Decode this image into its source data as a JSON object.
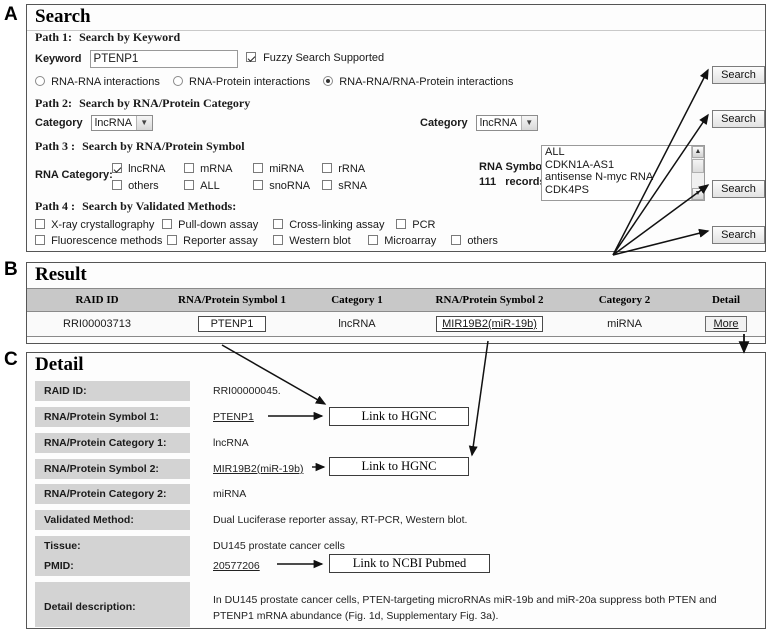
{
  "panels": {
    "a": {
      "letter": "A",
      "title": "Search"
    },
    "b": {
      "letter": "B",
      "title": "Result"
    },
    "c": {
      "letter": "C",
      "title": "Detail"
    }
  },
  "search": {
    "path1": {
      "num": "Path 1:",
      "title": "Search by Keyword"
    },
    "keyword_label": "Keyword",
    "keyword_value": "PTENP1",
    "fuzzy_label": "Fuzzy Search Supported",
    "fuzzy_checked": true,
    "interaction_types": [
      {
        "label": "RNA-RNA interactions",
        "selected": false
      },
      {
        "label": "RNA-Protein interactions",
        "selected": false
      },
      {
        "label": "RNA-RNA/RNA-Protein interactions",
        "selected": true
      }
    ],
    "path2": {
      "num": "Path 2:",
      "title": "Search by RNA/Protein Category"
    },
    "category_label_1": "Category",
    "category_value_1": "lncRNA",
    "category_label_2": "Category",
    "category_value_2": "lncRNA",
    "path3": {
      "num": "Path 3 :",
      "title": "Search by RNA/Protein Symbol"
    },
    "rna_category_label": "RNA Category:",
    "rna_categories_row1": [
      {
        "label": "lncRNA",
        "checked": true
      },
      {
        "label": "mRNA",
        "checked": false
      },
      {
        "label": "miRNA",
        "checked": false
      },
      {
        "label": "rRNA",
        "checked": false
      }
    ],
    "rna_categories_row2": [
      {
        "label": "others",
        "checked": false
      },
      {
        "label": "ALL",
        "checked": false
      },
      {
        "label": "snoRNA",
        "checked": false
      },
      {
        "label": "sRNA",
        "checked": false
      }
    ],
    "rna_symbol_label": "RNA Symbol:",
    "rna_symbol_count": "111",
    "rna_symbol_records": "records",
    "rna_symbol_options": [
      "ALL",
      "CDKN1A-AS1",
      "antisense N-myc RNA",
      "CDK4PS"
    ],
    "path4": {
      "num": "Path 4 :",
      "title": "Search by Validated Methods:"
    },
    "methods_row1": [
      {
        "label": "X-ray crystallography",
        "checked": false
      },
      {
        "label": "Pull-down assay",
        "checked": false
      },
      {
        "label": "Cross-linking assay",
        "checked": false
      },
      {
        "label": "PCR",
        "checked": false
      }
    ],
    "methods_row2": [
      {
        "label": "Fluorescence methods",
        "checked": false
      },
      {
        "label": "Reporter assay",
        "checked": false
      },
      {
        "label": "Western blot",
        "checked": false
      },
      {
        "label": "Microarray",
        "checked": false
      },
      {
        "label": "others",
        "checked": false
      }
    ],
    "search_buttons": [
      "Search",
      "Search",
      "Search",
      "Search"
    ]
  },
  "result": {
    "headers": [
      "RAID ID",
      "RNA/Protein Symbol 1",
      "Category 1",
      "RNA/Protein Symbol 2",
      "Category 2",
      "Detail"
    ],
    "row": {
      "raid_id": "RRI00003713",
      "symbol1": "PTENP1",
      "category1": "lncRNA",
      "symbol2": "MIR19B2(miR-19b)",
      "category2": "miRNA",
      "detail": "More"
    }
  },
  "detail": {
    "fields": [
      {
        "label": "RAID ID:",
        "value": "RRI00000045."
      },
      {
        "label": "RNA/Protein Symbol 1:",
        "value": "PTENP1"
      },
      {
        "label": "RNA/Protein Category 1:",
        "value": "lncRNA"
      },
      {
        "label": "RNA/Protein Symbol 2:",
        "value": "MIR19B2(miR-19b)"
      },
      {
        "label": "RNA/Protein Category 2:",
        "value": "miRNA"
      },
      {
        "label": "Validated Method:",
        "value": "Dual Luciferase reporter assay, RT-PCR, Western blot."
      },
      {
        "label": "Tissue:",
        "value": "DU145 prostate cancer cells"
      },
      {
        "label": "PMID:",
        "value": "20577206"
      },
      {
        "label": "Detail description:",
        "value": ""
      }
    ],
    "link_hgnc_1": "Link to HGNC",
    "link_hgnc_2": "Link to HGNC",
    "link_pubmed": "Link to NCBI Pubmed",
    "description": "In DU145 prostate cancer cells, PTEN-targeting microRNAs miR-19b and miR-20a suppress both PTEN and PTENP1 mRNA abundance (Fig. 1d, Supplementary Fig. 3a)."
  }
}
